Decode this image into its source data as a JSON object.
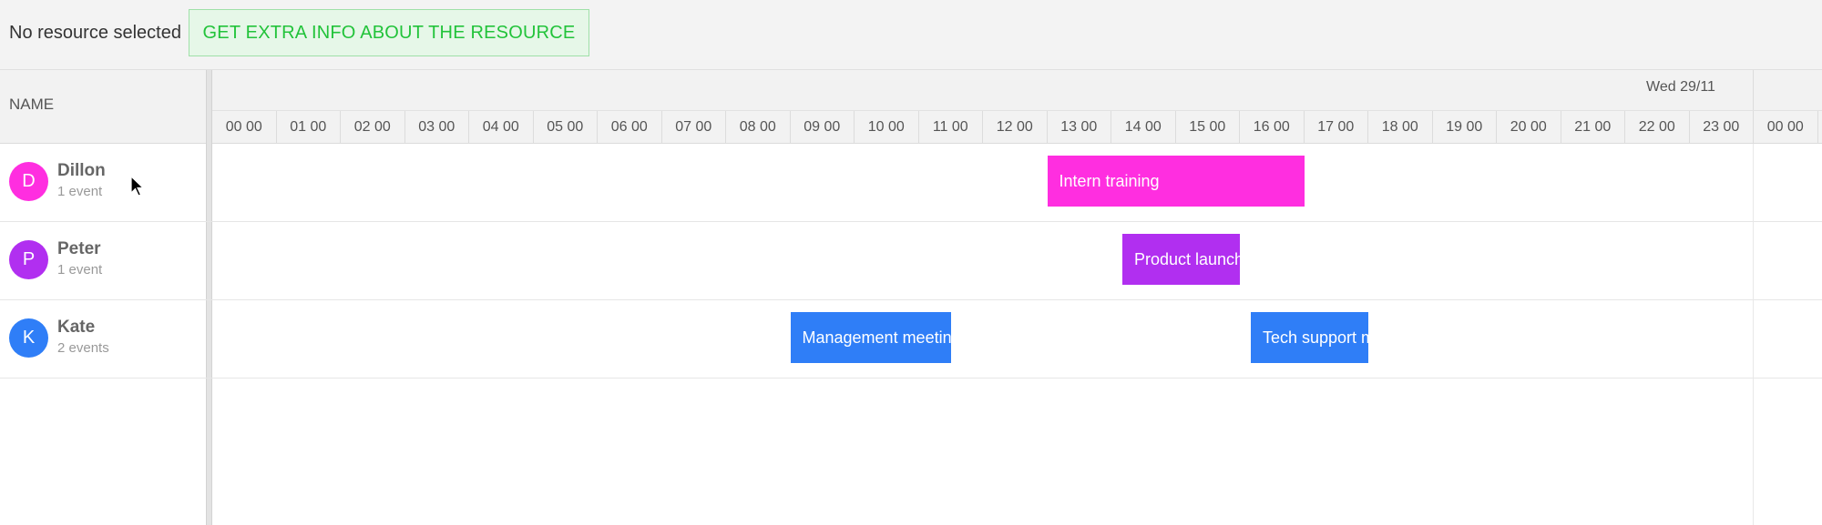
{
  "toolbar": {
    "status_text": "No resource selected",
    "extra_info_button": "GET EXTRA INFO ABOUT THE RESOURCE"
  },
  "header": {
    "name_column": "NAME",
    "day_label": "Wed 29/11",
    "hours": [
      "00 00",
      "01 00",
      "02 00",
      "03 00",
      "04 00",
      "05 00",
      "06 00",
      "07 00",
      "08 00",
      "09 00",
      "10 00",
      "11 00",
      "12 00",
      "13 00",
      "14 00",
      "15 00",
      "16 00",
      "17 00",
      "18 00",
      "19 00",
      "20 00",
      "21 00",
      "22 00",
      "23 00",
      "00 00"
    ]
  },
  "resources": [
    {
      "initial": "D",
      "name": "Dillon",
      "count": "1 event",
      "color": "#ff2ee0",
      "events": [
        {
          "title": "Intern training",
          "start": 13.0,
          "end": 17.0
        }
      ]
    },
    {
      "initial": "P",
      "name": "Peter",
      "count": "1 event",
      "color": "#b12ff0",
      "events": [
        {
          "title": "Product launch",
          "start": 14.17,
          "end": 16.0
        }
      ]
    },
    {
      "initial": "K",
      "name": "Kate",
      "count": "2 events",
      "color": "#2f7ef7",
      "events": [
        {
          "title": "Management meeting",
          "start": 9.0,
          "end": 11.5
        },
        {
          "title": "Tech support meeting",
          "start": 16.17,
          "end": 18.0
        }
      ]
    }
  ],
  "icons": {
    "cursor": "mouse-pointer-icon"
  }
}
